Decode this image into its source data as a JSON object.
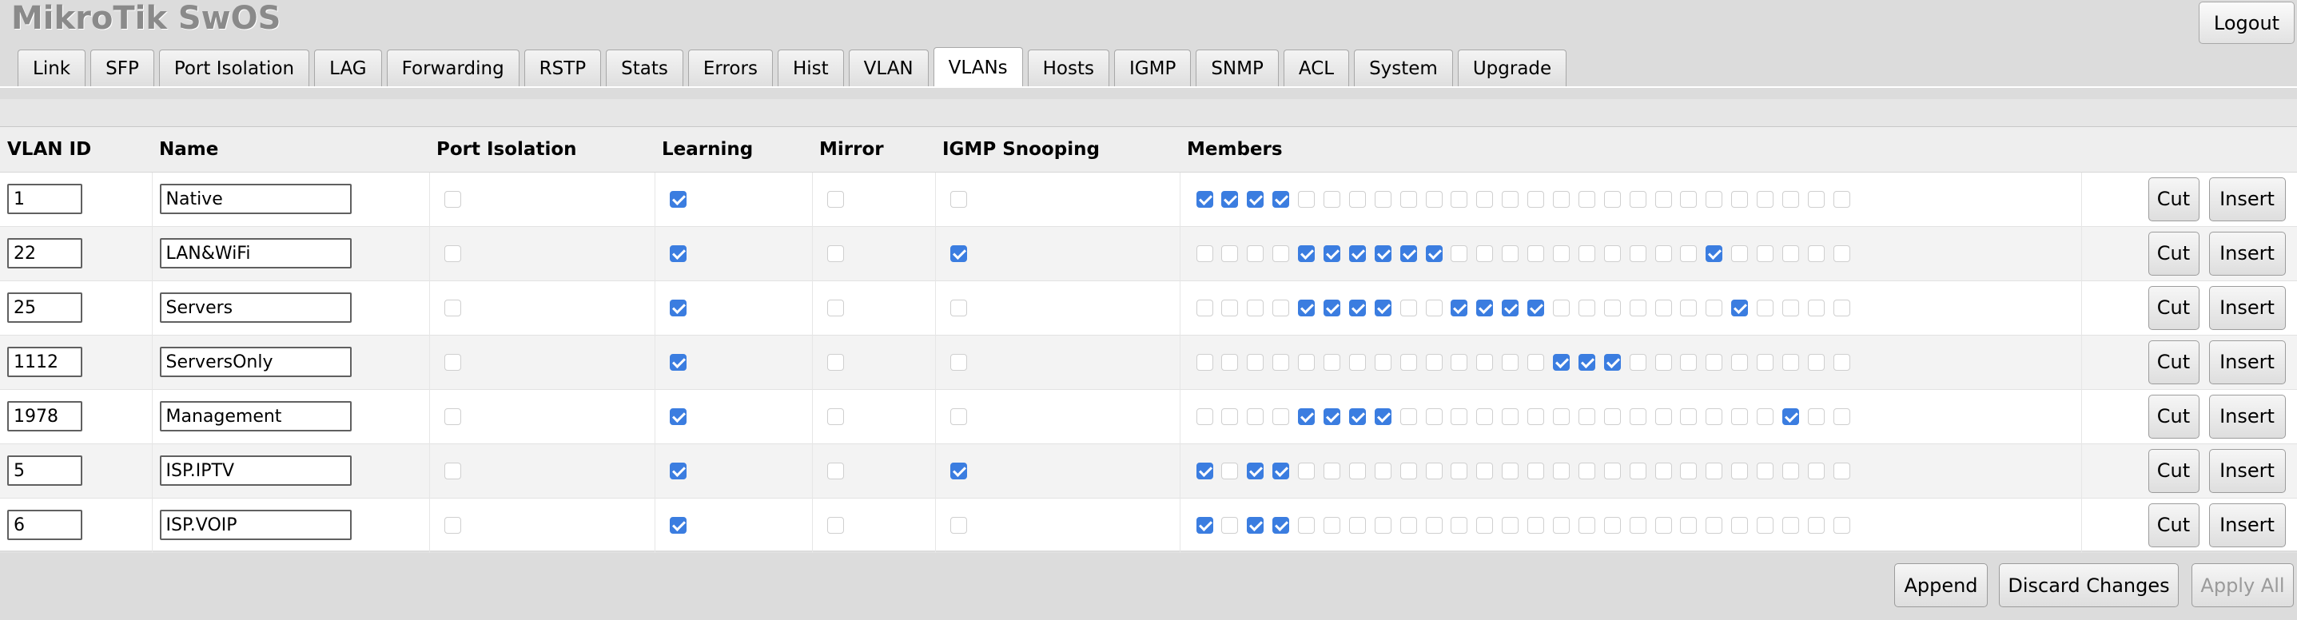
{
  "header": {
    "app_title": "MikroTik SwOS",
    "logout_label": "Logout"
  },
  "tabs": [
    {
      "label": "Link",
      "active": false
    },
    {
      "label": "SFP",
      "active": false
    },
    {
      "label": "Port Isolation",
      "active": false
    },
    {
      "label": "LAG",
      "active": false
    },
    {
      "label": "Forwarding",
      "active": false
    },
    {
      "label": "RSTP",
      "active": false
    },
    {
      "label": "Stats",
      "active": false
    },
    {
      "label": "Errors",
      "active": false
    },
    {
      "label": "Hist",
      "active": false
    },
    {
      "label": "VLAN",
      "active": false
    },
    {
      "label": "VLANs",
      "active": true
    },
    {
      "label": "Hosts",
      "active": false
    },
    {
      "label": "IGMP",
      "active": false
    },
    {
      "label": "SNMP",
      "active": false
    },
    {
      "label": "ACL",
      "active": false
    },
    {
      "label": "System",
      "active": false
    },
    {
      "label": "Upgrade",
      "active": false
    }
  ],
  "table": {
    "columns": {
      "vlan_id": "VLAN ID",
      "name": "Name",
      "port_isolation": "Port Isolation",
      "learning": "Learning",
      "mirror": "Mirror",
      "igmp_snooping": "IGMP Snooping",
      "members": "Members"
    },
    "rows": [
      {
        "vlan_id": "1",
        "name": "Native",
        "port_isolation": false,
        "learning": true,
        "mirror": false,
        "igmp_snooping": false,
        "members": [
          1,
          1,
          1,
          1,
          0,
          0,
          0,
          0,
          0,
          0,
          0,
          0,
          0,
          0,
          0,
          0,
          0,
          0,
          0,
          0,
          0,
          0,
          0,
          0,
          0,
          0
        ]
      },
      {
        "vlan_id": "22",
        "name": "LAN&WiFi",
        "port_isolation": false,
        "learning": true,
        "mirror": false,
        "igmp_snooping": true,
        "members": [
          0,
          0,
          0,
          0,
          1,
          1,
          1,
          1,
          1,
          1,
          0,
          0,
          0,
          0,
          0,
          0,
          0,
          0,
          0,
          0,
          1,
          0,
          0,
          0,
          0,
          0
        ]
      },
      {
        "vlan_id": "25",
        "name": "Servers",
        "port_isolation": false,
        "learning": true,
        "mirror": false,
        "igmp_snooping": false,
        "members": [
          0,
          0,
          0,
          0,
          1,
          1,
          1,
          1,
          0,
          0,
          1,
          1,
          1,
          1,
          0,
          0,
          0,
          0,
          0,
          0,
          0,
          1,
          0,
          0,
          0,
          0
        ]
      },
      {
        "vlan_id": "1112",
        "name": "ServersOnly",
        "port_isolation": false,
        "learning": true,
        "mirror": false,
        "igmp_snooping": false,
        "members": [
          0,
          0,
          0,
          0,
          0,
          0,
          0,
          0,
          0,
          0,
          0,
          0,
          0,
          0,
          1,
          1,
          1,
          0,
          0,
          0,
          0,
          0,
          0,
          0,
          0,
          0
        ]
      },
      {
        "vlan_id": "1978",
        "name": "Management",
        "port_isolation": false,
        "learning": true,
        "mirror": false,
        "igmp_snooping": false,
        "members": [
          0,
          0,
          0,
          0,
          1,
          1,
          1,
          1,
          0,
          0,
          0,
          0,
          0,
          0,
          0,
          0,
          0,
          0,
          0,
          0,
          0,
          0,
          0,
          1,
          0,
          0
        ]
      },
      {
        "vlan_id": "5",
        "name": "ISP.IPTV",
        "port_isolation": false,
        "learning": true,
        "mirror": false,
        "igmp_snooping": true,
        "members": [
          1,
          0,
          1,
          1,
          0,
          0,
          0,
          0,
          0,
          0,
          0,
          0,
          0,
          0,
          0,
          0,
          0,
          0,
          0,
          0,
          0,
          0,
          0,
          0,
          0,
          0
        ]
      },
      {
        "vlan_id": "6",
        "name": "ISP.VOIP",
        "port_isolation": false,
        "learning": true,
        "mirror": false,
        "igmp_snooping": false,
        "members": [
          1,
          0,
          1,
          1,
          0,
          0,
          0,
          0,
          0,
          0,
          0,
          0,
          0,
          0,
          0,
          0,
          0,
          0,
          0,
          0,
          0,
          0,
          0,
          0,
          0,
          0
        ]
      }
    ],
    "cut_label": "Cut",
    "insert_label": "Insert"
  },
  "footer": {
    "append_label": "Append",
    "discard_label": "Discard Changes",
    "apply_label": "Apply All"
  },
  "colors": {
    "checkbox_checked": "#3b7de0",
    "background": "#dcdcdc"
  }
}
